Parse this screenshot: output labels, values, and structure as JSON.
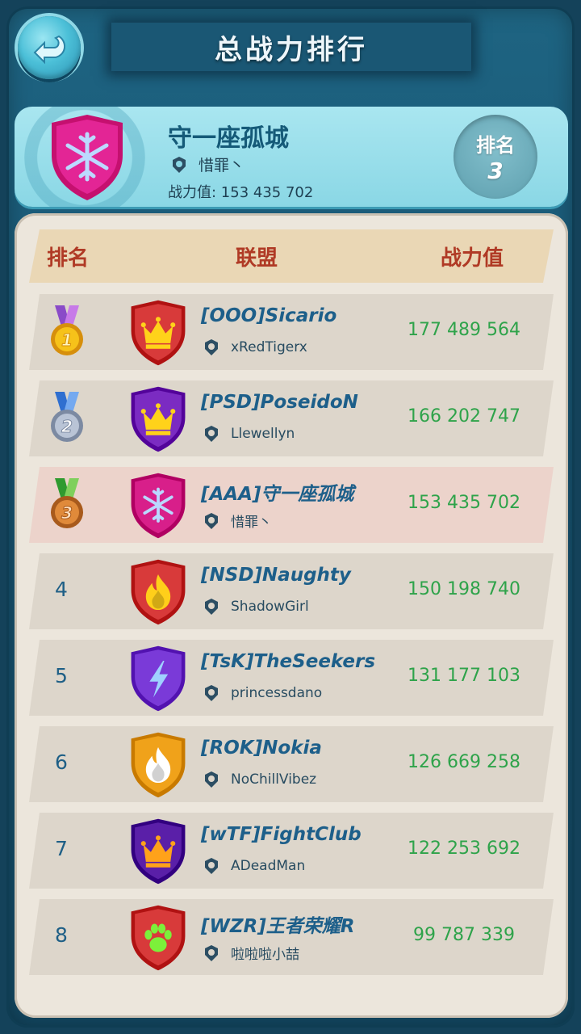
{
  "header": {
    "title": "总战力排行",
    "back_icon": "back-arrow-icon"
  },
  "my_alliance": {
    "name": "守一座孤城",
    "leader": "惜罪丶",
    "power_text": "战力值: 153 435 702",
    "rank_label": "排名",
    "rank_value": "3",
    "emblem": "snowflake-icon",
    "emblem_color": "#d81f8a"
  },
  "columns": {
    "rank": "排名",
    "alliance": "联盟",
    "power": "战力值"
  },
  "rows": [
    {
      "rank": "1",
      "medal": "gold",
      "tag": "[OOO]Sicario",
      "leader": "xRedTigerx",
      "power": "177 489 564",
      "emblem": "crown-icon",
      "color": "#d83a3a",
      "accent": "#ffd21a"
    },
    {
      "rank": "2",
      "medal": "silver",
      "tag": "[PSD]PoseidoN",
      "leader": "Llewellyn",
      "power": "166 202 747",
      "emblem": "crown-icon",
      "color": "#7b2bc2",
      "accent": "#ffd21a"
    },
    {
      "rank": "3",
      "medal": "bronze",
      "tag": "[AAA]守一座孤城",
      "leader": "惜罪丶",
      "power": "153 435 702",
      "emblem": "snowflake-icon",
      "color": "#d81f8a",
      "accent": "#b9d8ff",
      "highlight": true
    },
    {
      "rank": "4",
      "tag": "[NSD]Naughty",
      "leader": "ShadowGirl",
      "power": "150 198 740",
      "emblem": "flame-icon",
      "color": "#d83a3a",
      "accent": "#ffcf1a"
    },
    {
      "rank": "5",
      "tag": "[TsK]TheSeekers",
      "leader": "princessdano",
      "power": "131 177 103",
      "emblem": "lightning-icon",
      "color": "#7a3ad8",
      "accent": "#9fd0ff"
    },
    {
      "rank": "6",
      "tag": "[ROK]Nokia",
      "leader": "NoChillVibez",
      "power": "126 669 258",
      "emblem": "flame-icon",
      "color": "#f0a21a",
      "accent": "#ffffff"
    },
    {
      "rank": "7",
      "tag": "[wTF]FightClub",
      "leader": "ADeadMan",
      "power": "122 253 692",
      "emblem": "crown-icon",
      "color": "#5a1fa8",
      "accent": "#ffa21a"
    },
    {
      "rank": "8",
      "tag": "[WZR]王者荣耀R",
      "leader": "啦啦啦小喆",
      "power": "99 787 339",
      "emblem": "paw-icon",
      "color": "#d83a3a",
      "accent": "#7cf03a"
    }
  ],
  "colors": {
    "rank_blue": "#1e5f86",
    "power_green": "#2ea34a",
    "header_red": "#b03a25"
  }
}
